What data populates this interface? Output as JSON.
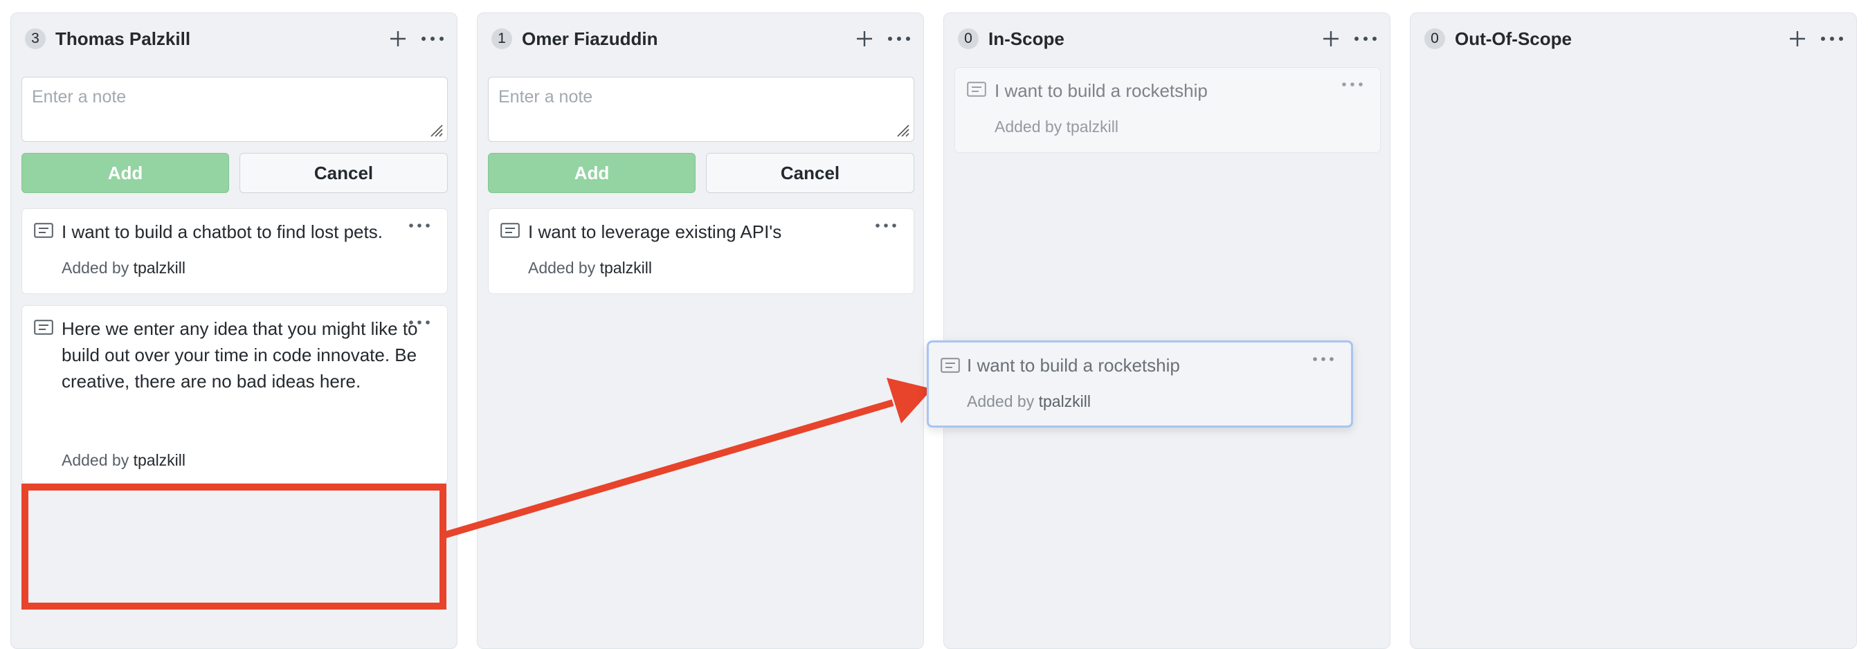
{
  "columns": [
    {
      "count": "3",
      "title": "Thomas Palzkill",
      "note_placeholder": "Enter a note",
      "add_label": "Add",
      "cancel_label": "Cancel",
      "cards": [
        {
          "text": "I want to build a chatbot to find lost pets.",
          "added_by": "Added by",
          "user": "tpalzkill"
        },
        {
          "text": "Here we enter any idea that you might like to build out over your time in code innovate. Be creative, there are no bad ideas here.",
          "added_by": "Added by",
          "user": "tpalzkill"
        }
      ]
    },
    {
      "count": "1",
      "title": "Omer Fiazuddin",
      "note_placeholder": "Enter a note",
      "add_label": "Add",
      "cancel_label": "Cancel",
      "cards": [
        {
          "text": "I want to leverage existing API's",
          "added_by": "Added by",
          "user": "tpalzkill"
        }
      ]
    },
    {
      "count": "0",
      "title": "In-Scope",
      "cards": [
        {
          "text": "I want to build a rocketship",
          "added_by": "Added by",
          "user": "tpalzkill"
        }
      ]
    },
    {
      "count": "0",
      "title": "Out-Of-Scope",
      "cards": []
    }
  ],
  "dragging_card": {
    "text": "I want to build a rocketship",
    "added_by": "Added by",
    "user": "tpalzkill"
  },
  "icons": {
    "add": "plus-icon",
    "menu": "kebab-dots-icon",
    "note": "note-icon"
  },
  "colors": {
    "annotation": "#e8432b",
    "drag_border": "#a9c4f2",
    "add_button": "#94d3a2"
  }
}
